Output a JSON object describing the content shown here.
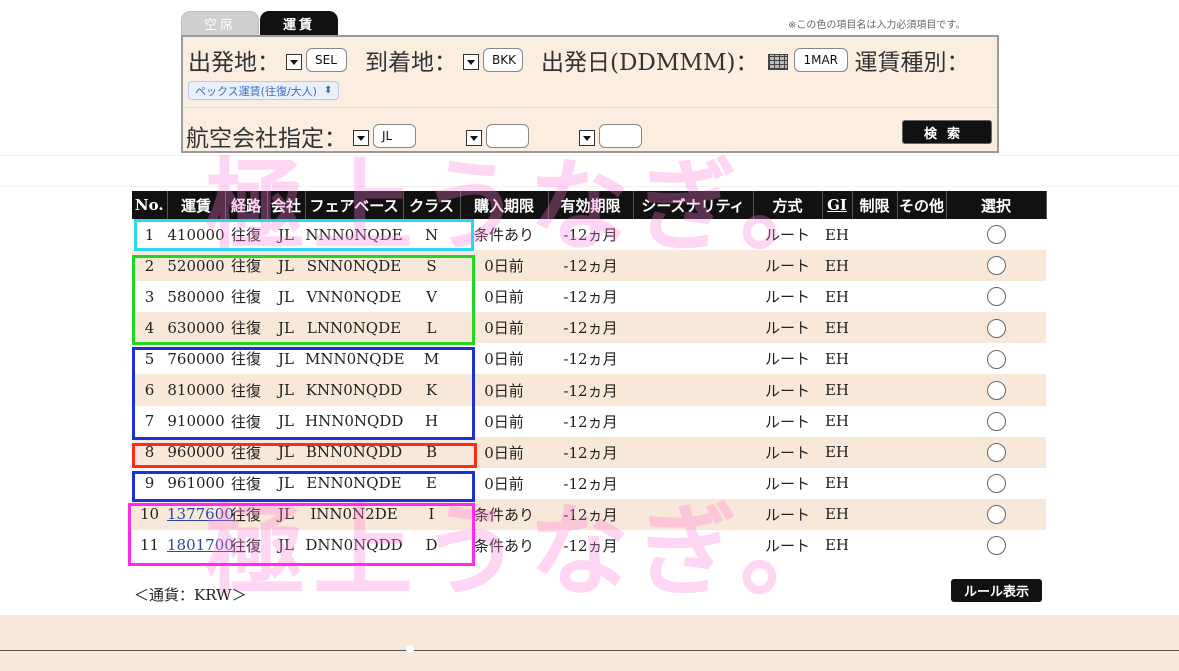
{
  "tabs": [
    {
      "label": "空席",
      "active": false
    },
    {
      "label": "運賃",
      "active": true
    }
  ],
  "note": "※この色の項目名は入力必須項目です。",
  "search": {
    "departure_label": "出発地：",
    "departure_value": "SEL",
    "arrival_label": "到着地：",
    "arrival_value": "BKK",
    "date_label": "出発日(DDMMM)：",
    "date_value": "1MAR",
    "fare_type_label": "運賃種別：",
    "fare_type_value": "ペックス運賃(往復/大人)",
    "airline_label": "航空会社指定：",
    "airline_value": "JL",
    "airline_value2": "",
    "airline_value3": "",
    "search_button": "検索"
  },
  "table": {
    "headers": [
      "No.",
      "運賃",
      "経路",
      "会社",
      "フェアベース",
      "クラス",
      "購入期限",
      "有効期限",
      "シーズナリティ",
      "方式",
      "GI",
      "制限",
      "その他",
      "選択"
    ],
    "rows": [
      {
        "no": "1",
        "fare": "410000",
        "link": false,
        "route": "往復",
        "airline": "JL",
        "basis": "NNN0NQDE",
        "cls": "N",
        "purchase": "条件あり",
        "validity": "-12ヵ月",
        "season": "",
        "method": "ルート",
        "gi": "EH",
        "restrict": "",
        "other": ""
      },
      {
        "no": "2",
        "fare": "520000",
        "link": false,
        "route": "往復",
        "airline": "JL",
        "basis": "SNN0NQDE",
        "cls": "S",
        "purchase": "0日前",
        "validity": "-12ヵ月",
        "season": "",
        "method": "ルート",
        "gi": "EH",
        "restrict": "",
        "other": ""
      },
      {
        "no": "3",
        "fare": "580000",
        "link": false,
        "route": "往復",
        "airline": "JL",
        "basis": "VNN0NQDE",
        "cls": "V",
        "purchase": "0日前",
        "validity": "-12ヵ月",
        "season": "",
        "method": "ルート",
        "gi": "EH",
        "restrict": "",
        "other": ""
      },
      {
        "no": "4",
        "fare": "630000",
        "link": false,
        "route": "往復",
        "airline": "JL",
        "basis": "LNN0NQDE",
        "cls": "L",
        "purchase": "0日前",
        "validity": "-12ヵ月",
        "season": "",
        "method": "ルート",
        "gi": "EH",
        "restrict": "",
        "other": ""
      },
      {
        "no": "5",
        "fare": "760000",
        "link": false,
        "route": "往復",
        "airline": "JL",
        "basis": "MNN0NQDE",
        "cls": "M",
        "purchase": "0日前",
        "validity": "-12ヵ月",
        "season": "",
        "method": "ルート",
        "gi": "EH",
        "restrict": "",
        "other": ""
      },
      {
        "no": "6",
        "fare": "810000",
        "link": false,
        "route": "往復",
        "airline": "JL",
        "basis": "KNN0NQDD",
        "cls": "K",
        "purchase": "0日前",
        "validity": "-12ヵ月",
        "season": "",
        "method": "ルート",
        "gi": "EH",
        "restrict": "",
        "other": ""
      },
      {
        "no": "7",
        "fare": "910000",
        "link": false,
        "route": "往復",
        "airline": "JL",
        "basis": "HNN0NQDD",
        "cls": "H",
        "purchase": "0日前",
        "validity": "-12ヵ月",
        "season": "",
        "method": "ルート",
        "gi": "EH",
        "restrict": "",
        "other": ""
      },
      {
        "no": "8",
        "fare": "960000",
        "link": false,
        "route": "往復",
        "airline": "JL",
        "basis": "BNN0NQDD",
        "cls": "B",
        "purchase": "0日前",
        "validity": "-12ヵ月",
        "season": "",
        "method": "ルート",
        "gi": "EH",
        "restrict": "",
        "other": ""
      },
      {
        "no": "9",
        "fare": "961000",
        "link": false,
        "route": "往復",
        "airline": "JL",
        "basis": "ENN0NQDE",
        "cls": "E",
        "purchase": "0日前",
        "validity": "-12ヵ月",
        "season": "",
        "method": "ルート",
        "gi": "EH",
        "restrict": "",
        "other": ""
      },
      {
        "no": "10",
        "fare": "1377600",
        "link": true,
        "route": "往復",
        "airline": "JL",
        "basis": "INN0N2DE",
        "cls": "I",
        "purchase": "条件あり",
        "validity": "-12ヵ月",
        "season": "",
        "method": "ルート",
        "gi": "EH",
        "restrict": "",
        "other": ""
      },
      {
        "no": "11",
        "fare": "1801700",
        "link": true,
        "route": "往復",
        "airline": "JL",
        "basis": "DNN0NQDD",
        "cls": "D",
        "purchase": "条件あり",
        "validity": "-12ヵ月",
        "season": "",
        "method": "ルート",
        "gi": "EH",
        "restrict": "",
        "other": ""
      }
    ]
  },
  "currency_note": "＜通貨：KRW＞",
  "rule_button": "ルール表示",
  "watermark": "極上うなぎ。",
  "colors": {
    "header_bg": "#111111",
    "panel_bg": "#fbeee0",
    "row_alt": "#f8e8d9",
    "link": "#2a46a8",
    "box_cyan": "#29d9f0",
    "box_green": "#22d622",
    "box_blue": "#1f2fd8",
    "box_red": "#ff2a1a",
    "box_magenta": "#ff2aea",
    "watermark": "#ff7ad8"
  }
}
